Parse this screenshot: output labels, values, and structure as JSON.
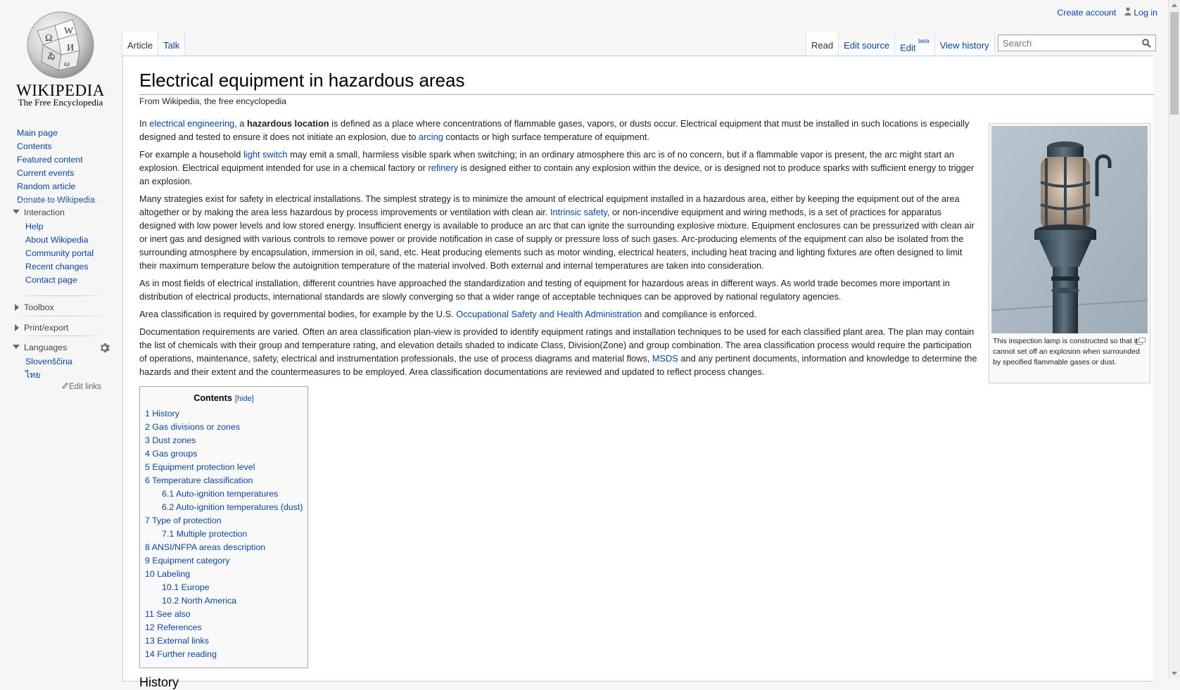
{
  "logo": {
    "wordmark": "Wikipedia",
    "tagline": "The Free Encyclopedia"
  },
  "personal": {
    "create_account": "Create account",
    "login": "Log in",
    "user_icon": "user-icon"
  },
  "left_tabs": [
    "Article",
    "Talk"
  ],
  "right_tabs": {
    "read": "Read",
    "edit_source": "Edit source",
    "edit": "Edit",
    "edit_sup": "beta",
    "history": "View history"
  },
  "search": {
    "placeholder": "Search"
  },
  "navigation": [
    "Main page",
    "Contents",
    "Featured content",
    "Current events",
    "Random article",
    "Donate to Wikipedia"
  ],
  "interaction": {
    "heading": "Interaction",
    "items": [
      "Help",
      "About Wikipedia",
      "Community portal",
      "Recent changes",
      "Contact page"
    ]
  },
  "toolbox": {
    "heading": "Toolbox"
  },
  "print": {
    "heading": "Print/export"
  },
  "languages": {
    "heading": "Languages",
    "items": [
      "Slovenščina",
      "ไทย"
    ],
    "edit_links": "Edit links"
  },
  "article": {
    "title": "Electrical equipment in hazardous areas",
    "site_sub": "From Wikipedia, the free encyclopedia",
    "p1": {
      "a": "In ",
      "b": "electrical engineering",
      "c": ", a ",
      "d": "hazardous location",
      "e": " is defined as a place where concentrations of flammable gases, vapors, or dusts occur. Electrical equipment that must be installed in such locations is especially designed and tested to ensure it does not initiate an explosion, due to ",
      "f": "arcing",
      "g": " contacts or high surface temperature of equipment."
    },
    "p2": {
      "a": "For example a household ",
      "b": "light switch",
      "c": " may emit a small, harmless visible spark when switching; in an ordinary atmosphere this arc is of no concern, but if a flammable vapor is present, the arc might start an explosion. Electrical equipment intended for use in a chemical factory or ",
      "d": "refinery",
      "e": " is designed either to contain any explosion within the device, or is designed not to produce sparks with sufficient energy to trigger an explosion."
    },
    "p3": {
      "a": "Many strategies exist for safety in electrical installations. The simplest strategy is to minimize the amount of electrical equipment installed in a hazardous area, either by keeping the equipment out of the area altogether or by making the area less hazardous by process improvements or ventilation with clean air. ",
      "b": "Intrinsic safety",
      "c": ", or non-incendive equipment and wiring methods, is a set of practices for apparatus designed with low power levels and low stored energy. Insufficient energy is available to produce an arc that can ignite the surrounding explosive mixture. Equipment enclosures can be pressurized with clean air or inert gas and designed with various controls to remove power or provide notification in case of supply or pressure loss of such gases. Arc-producing elements of the equipment can also be isolated from the surrounding atmosphere by encapsulation, immersion in oil, sand, etc. Heat producing elements such as motor winding, electrical heaters, including heat tracing and lighting fixtures are often designed to limit their maximum temperature below the autoignition temperature of the material involved. Both external and internal temperatures are taken into consideration."
    },
    "p4": "As in most fields of electrical installation, different countries have approached the standardization and testing of equipment for hazardous areas in different ways. As world trade becomes more important in distribution of electrical products, international standards are slowly converging so that a wider range of acceptable techniques can be approved by national regulatory agencies.",
    "p5": {
      "a": "Area classification is required by governmental bodies, for example by the U.S. ",
      "b": "Occupational Safety and Health Administration",
      "c": " and compliance is enforced."
    },
    "p6": {
      "a": "Documentation requirements are varied. Often an area classification plan-view is provided to identify equipment ratings and installation techniques to be used for each classified plant area. The plan may contain the list of chemicals with their group and temperature rating, and elevation details shaded to indicate Class, Division(Zone) and group combination. The area classification process would require the participation of operations, maintenance, safety, electrical and instrumentation professionals, the use of process diagrams and material flows, ",
      "b": "MSDS",
      "c": " and any pertinent documents, information and knowledge to determine the hazards and their extent and the countermeasures to be employed. Area classification documentations are reviewed and updated to reflect process changes."
    },
    "thumb_caption": "This inspection lamp is constructed so that it cannot set off an explosion when surrounded by specified flammable gases or dust.",
    "next_heading": "History"
  },
  "toc": {
    "title": "Contents",
    "hide": "[hide]",
    "items": [
      {
        "num": "1",
        "text": "History"
      },
      {
        "num": "2",
        "text": "Gas divisions or zones"
      },
      {
        "num": "3",
        "text": "Dust zones"
      },
      {
        "num": "4",
        "text": "Gas groups"
      },
      {
        "num": "5",
        "text": "Equipment protection level"
      },
      {
        "num": "6",
        "text": "Temperature classification"
      },
      {
        "num": "6.1",
        "text": "Auto-ignition temperatures"
      },
      {
        "num": "6.2",
        "text": "Auto-ignition temperatures (dust)"
      },
      {
        "num": "7",
        "text": "Type of protection"
      },
      {
        "num": "7.1",
        "text": "Multiple protection"
      },
      {
        "num": "8",
        "text": "ANSI/NFPA areas description"
      },
      {
        "num": "9",
        "text": "Equipment category"
      },
      {
        "num": "10",
        "text": "Labeling"
      },
      {
        "num": "10.1",
        "text": "Europe"
      },
      {
        "num": "10.2",
        "text": "North America"
      },
      {
        "num": "11",
        "text": "See also"
      },
      {
        "num": "12",
        "text": "References"
      },
      {
        "num": "13",
        "text": "External links"
      },
      {
        "num": "14",
        "text": "Further reading"
      }
    ]
  },
  "colors": {
    "link": "#0645ad",
    "content_border": "#a7d7f9",
    "sidebar_bg": "#f6f6f6"
  }
}
